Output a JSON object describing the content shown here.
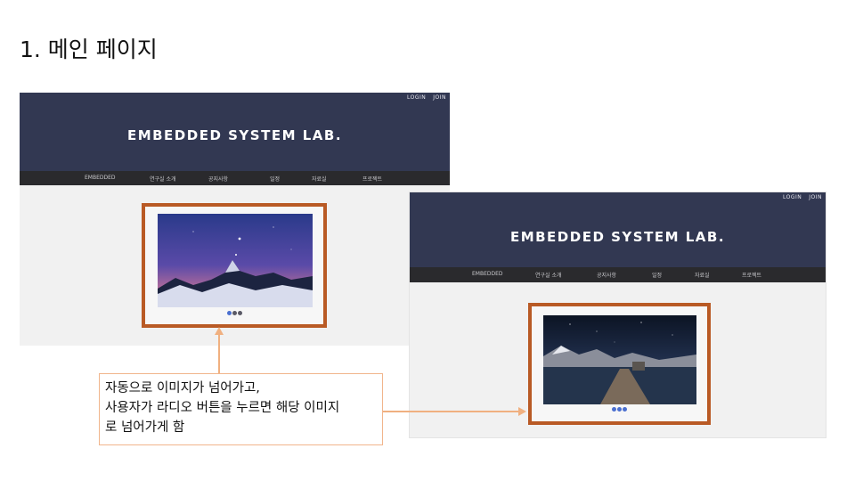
{
  "slide_title": "1. 메인 페이지",
  "site": {
    "title": "EMBEDDED SYSTEM LAB.",
    "util_links": [
      "LOGIN",
      "JOIN"
    ],
    "nav_items": [
      "EMBEDDED",
      "연구실 소개",
      "공지사항",
      "일정",
      "자료실",
      "프로젝트"
    ]
  },
  "callout": {
    "lines": [
      "자동으로 이미지가 넘어가고,",
      "사용자가 라디오 버튼을 누르면 해당 이미지",
      "로 넘어가게 함"
    ]
  },
  "slider": {
    "dots": 3,
    "screenshot1_active_dot": 1,
    "screenshot2_active_dot": 1
  },
  "colors": {
    "header_bg": "#323852",
    "nav_bg": "#2a2a2d",
    "frame_border": "#b95a25",
    "arrow": "#f0b080",
    "active_dot": "#4a6fd0"
  },
  "icons": [
    "mountain-night-photo",
    "lake-pier-night-photo",
    "slider-dot"
  ]
}
